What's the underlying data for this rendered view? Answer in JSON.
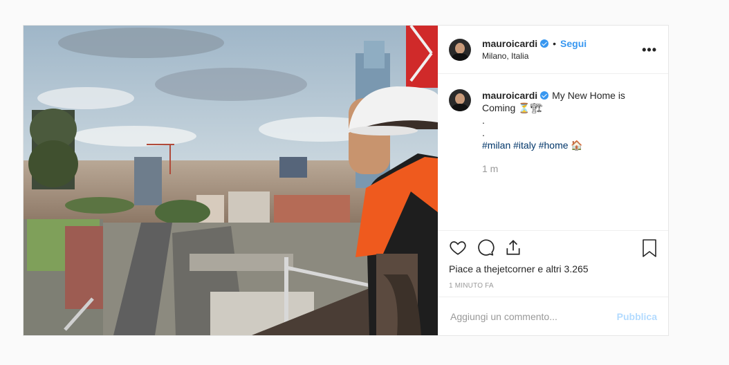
{
  "header": {
    "username": "mauroicardi",
    "separator": "•",
    "follow_label": "Segui",
    "location": "Milano, Italia",
    "more_label": "•••"
  },
  "caption": {
    "username": "mauroicardi",
    "text": "My New Home is\nComing ⏳🏗\n.\n.",
    "hashtags": [
      "#milan",
      "#italy",
      "#home"
    ],
    "hashtag_emoji": "🏠",
    "time_ago": "1 m"
  },
  "actions": {
    "like_icon": "heart-icon",
    "comment_icon": "comment-icon",
    "share_icon": "share-icon",
    "save_icon": "bookmark-icon"
  },
  "likes": {
    "prefix": "Piace a ",
    "user": "thejetcorner",
    "middle": " e ",
    "others": "altri 3.265"
  },
  "timestamp": "1 MINUTO FA",
  "comment": {
    "placeholder": "Aggiungi un commento...",
    "publish_label": "Pubblica"
  },
  "colors": {
    "accent": "#3897f0",
    "publish_disabled": "#b3dbff",
    "hashtag": "#003569"
  }
}
